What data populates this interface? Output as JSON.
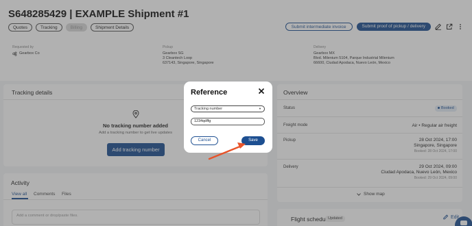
{
  "header": {
    "title": "S648285429 | EXAMPLE Shipment #1",
    "tabs": [
      "Quotes",
      "Tracking",
      "Billing",
      "Shipment Details"
    ],
    "submit_invoice": "Submit intermediate invoice",
    "submit_proof": "Submit proof of pickup / delivery"
  },
  "requested_by": {
    "label": "Requested by",
    "value": "Gearbox Co"
  },
  "pickup": {
    "label": "Pickup",
    "line1": "Gearbox SG",
    "line2": "3 Cleantech Loop",
    "line3": "637143, Singapore, Singapore"
  },
  "delivery": {
    "label": "Delivery",
    "line1": "Gearbox MX",
    "line2": "Blvd. Milenium 5104, Parque Industrial Milenium",
    "line3": "66600, Ciudad Apodaca, Nuevo León, Mexico"
  },
  "tracking": {
    "title": "Tracking details",
    "empty_title": "No tracking number added",
    "empty_sub": "Add a tracking number to get live updates",
    "add_button": "Add tracking number"
  },
  "activity": {
    "title": "Activity",
    "tabs": [
      "View all",
      "Comments",
      "Files"
    ],
    "placeholder": "Add a comment or drop/paste files."
  },
  "overview": {
    "title": "Overview",
    "status_label": "Status",
    "status_value": "Booked",
    "freight_label": "Freight mode",
    "freight_value": "Air • Regular air freight",
    "pickup_label": "Pickup",
    "pickup_date": "28 Oct 2024, 17:00",
    "pickup_place": "Singapore, Singapore",
    "pickup_booked": "Booked: 28 Oct 2024, 17:00",
    "delivery_label": "Delivery",
    "delivery_date": "29 Oct 2024, 09:00",
    "delivery_place": "Ciudad Apodaca, Nuevo León, Mexico",
    "delivery_booked": "Booked: 29 Oct 2024, 09:00",
    "show_map": "Show map"
  },
  "flight": {
    "title": "Flight schedule",
    "badge": "Updated",
    "edit": "Edit"
  },
  "modal": {
    "title": "Reference",
    "select_value": "Tracking number",
    "input_value": "1234qdffg",
    "cancel": "Cancel",
    "save": "Save"
  },
  "colors": {
    "primary": "#1d4f91",
    "arrow": "#e8542a",
    "overlay": "rgba(70,70,70,0.42)"
  }
}
